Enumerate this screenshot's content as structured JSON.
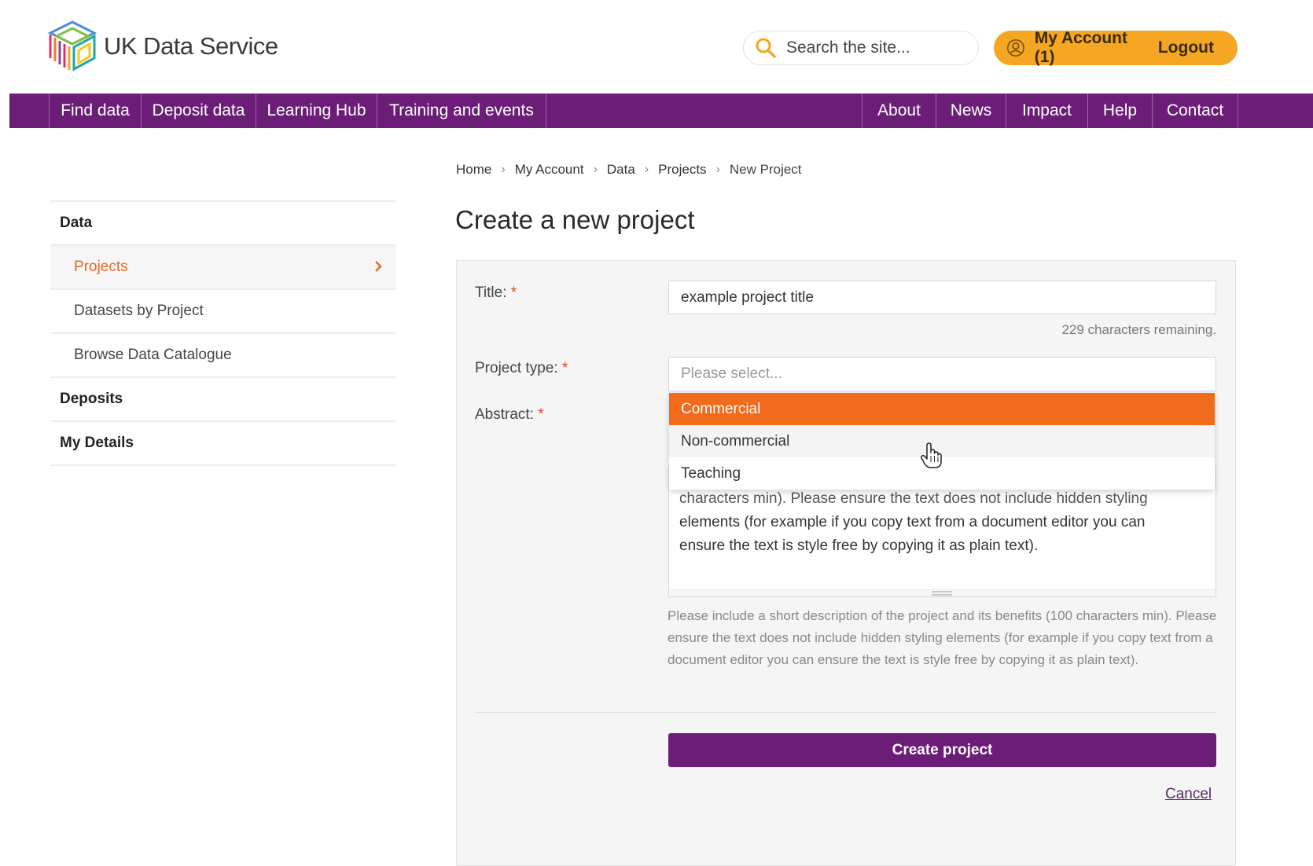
{
  "header": {
    "logo_text": "UK Data Service",
    "search_placeholder": "Search the site...",
    "account_label": "My Account (1)",
    "logout_label": "Logout",
    "accent_color": "#f5a623"
  },
  "nav": {
    "items_left": [
      "Find data",
      "Deposit data",
      "Learning Hub",
      "Training and events"
    ],
    "items_right": [
      "About",
      "News",
      "Impact",
      "Help",
      "Contact"
    ],
    "color": "#6c1d78"
  },
  "breadcrumb": [
    "Home",
    "My Account",
    "Data",
    "Projects",
    "New Project"
  ],
  "sidebar": {
    "data_heading": "Data",
    "projects": "Projects",
    "datasets_by_project": "Datasets by Project",
    "browse_catalogue": "Browse Data Catalogue",
    "deposits": "Deposits",
    "my_details": "My Details"
  },
  "main": {
    "title": "Create a new project",
    "title_label": "Title:",
    "title_value": "example project title",
    "remaining": "229 characters remaining.",
    "project_type_label": "Project type:",
    "project_type_placeholder": "Please select...",
    "project_type_options": [
      "Commercial",
      "Non-commercial",
      "Teaching"
    ],
    "abstract_label": "Abstract:",
    "abstract_partial_line": "characters min). Please ensure the text does not include hidden styling",
    "abstract_line_2": "elements (for example if you copy text from a document editor you can",
    "abstract_line_3": "ensure the text is style free by copying it as plain text).",
    "help_text": "Please include a short description of the project and its benefits (100 characters min). Please ensure the text does not include hidden styling elements (for example if you copy text from a document editor you can ensure the text is style free by copying it as plain text).",
    "required_marker": "*",
    "create_button": "Create project",
    "cancel": "Cancel"
  }
}
